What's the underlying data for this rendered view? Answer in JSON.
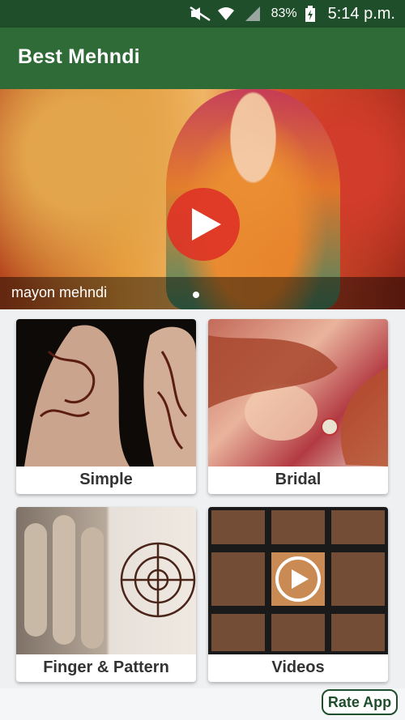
{
  "status_bar": {
    "battery": "83%",
    "time": "5:14 p.m."
  },
  "app": {
    "title": "Best Mehndi"
  },
  "hero": {
    "caption": "mayon mehndi"
  },
  "categories": [
    {
      "label": "Simple"
    },
    {
      "label": "Bridal"
    },
    {
      "label": "Finger & Pattern"
    },
    {
      "label": "Videos"
    }
  ],
  "footer": {
    "rate_label": "Rate App"
  },
  "colors": {
    "status_bar": "#1f4e2a",
    "app_bar": "#2f6b37",
    "play_button": "#de3426"
  },
  "icons": [
    "mute-icon",
    "wifi-icon",
    "signal-icon",
    "battery-icon",
    "play-icon"
  ]
}
